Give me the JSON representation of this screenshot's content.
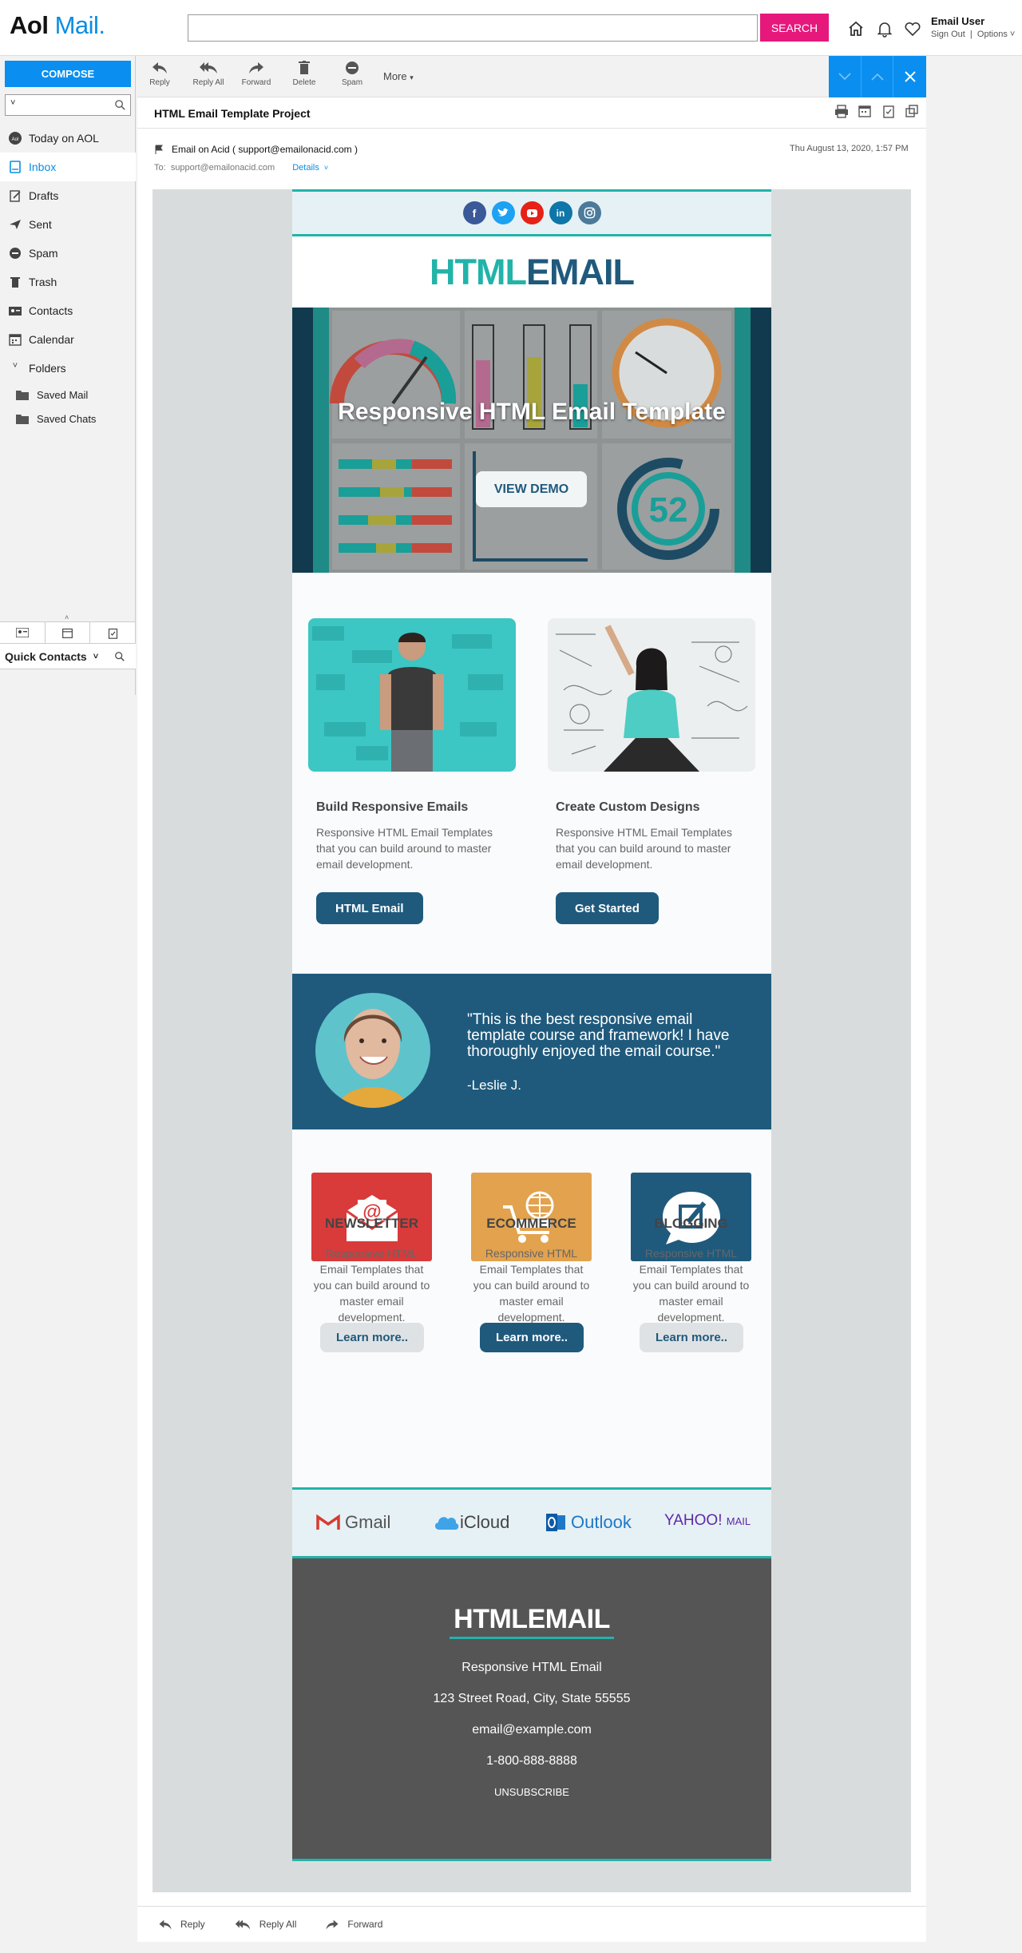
{
  "header": {
    "logo_brand": "Aol",
    "logo_product": "Mail.",
    "search_placeholder": "",
    "search_button": "SEARCH",
    "user_name": "Email User",
    "sign_out": "Sign Out",
    "options": "Options"
  },
  "sidebar": {
    "compose": "COMPOSE",
    "items": [
      {
        "label": "Today on AOL",
        "icon": "aol-icon"
      },
      {
        "label": "Inbox",
        "icon": "inbox-icon"
      },
      {
        "label": "Drafts",
        "icon": "drafts-icon"
      },
      {
        "label": "Sent",
        "icon": "sent-icon"
      },
      {
        "label": "Spam",
        "icon": "spam-icon"
      },
      {
        "label": "Trash",
        "icon": "trash-icon"
      },
      {
        "label": "Contacts",
        "icon": "contacts-icon"
      },
      {
        "label": "Calendar",
        "icon": "calendar-icon"
      }
    ],
    "folders_label": "Folders",
    "folders": [
      "Saved Mail",
      "Saved Chats"
    ],
    "quick_contacts": "Quick Contacts"
  },
  "toolbar": {
    "reply": "Reply",
    "reply_all": "Reply All",
    "forward": "Forward",
    "delete": "Delete",
    "spam": "Spam",
    "more": "More"
  },
  "message": {
    "subject": "HTML Email Template Project",
    "sender_name": "Email on Acid",
    "sender_email": "support@emailonacid.com",
    "to_label": "To:",
    "to_email": "support@emailonacid.com",
    "details": "Details",
    "date": "Thu August 13, 2020, 1:57 PM"
  },
  "email": {
    "brand_a": "HTML",
    "brand_b": "EMAIL",
    "hero_title": "Responsive HTML Email Template",
    "hero_button": "VIEW DEMO",
    "gauge_number": "52",
    "cards": [
      {
        "title": "Build Responsive Emails",
        "text": "Responsive HTML Email Templates that you can build around to master email development.",
        "button": "HTML Email"
      },
      {
        "title": "Create Custom Designs",
        "text": "Responsive HTML Email Templates that you can build around to master email development.",
        "button": "Get Started"
      }
    ],
    "quote": "\"This is the best responsive email template course and framework! I have thoroughly enjoyed the email course.\"",
    "quote_author": "-Leslie J.",
    "features": [
      {
        "title": "NEWSLETTER",
        "text": "Responsive HTML Email Templates that you can build around to master email development.",
        "button": "Learn more..",
        "color": "#d93a3a"
      },
      {
        "title": "ECOMMERCE",
        "text": "Responsive HTML Email Templates that you can build around to master email development.",
        "button": "Learn more..",
        "color": "#e2a24e"
      },
      {
        "title": "BLOGGING",
        "text": "Responsive HTML Email Templates that you can build around to master email development.",
        "button": "Learn more..",
        "color": "#1f5a7d"
      }
    ],
    "clients": [
      "Gmail",
      "iCloud",
      "Outlook",
      "YAHOO!",
      "MAIL"
    ],
    "footer": {
      "logo": "HTMLEMAIL",
      "tagline": "Responsive HTML Email",
      "address": "123 Street Road, City, State 55555",
      "email": "email@example.com",
      "phone": "1-800-888-8888",
      "unsubscribe": "UNSUBSCRIBE"
    }
  },
  "bottom_actions": {
    "reply": "Reply",
    "reply_all": "Reply All",
    "forward": "Forward"
  },
  "colors": {
    "aol_blue": "#0a8ff0",
    "search_pink": "#e6187c",
    "teal": "#22b3a9",
    "navy": "#1f5a7d"
  }
}
